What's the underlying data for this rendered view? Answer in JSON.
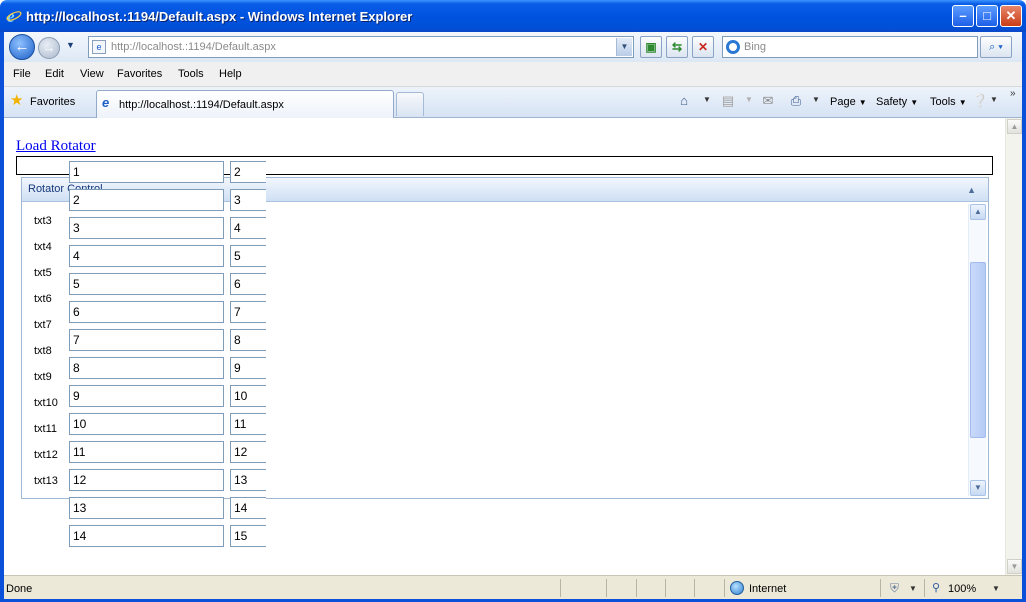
{
  "window": {
    "title": "http://localhost.:1194/Default.aspx - Windows Internet Explorer",
    "minimize": "–",
    "maximize": "□",
    "close": "✕"
  },
  "nav": {
    "address": "http://localhost.:1194/Default.aspx",
    "search_placeholder": "Bing",
    "back_glyph": "←",
    "forward_glyph": "→",
    "refresh_glyph": "⇆",
    "stop_glyph": "✕",
    "compat_glyph": "▣",
    "search_glyph": "⌕"
  },
  "menu": {
    "items": [
      "File",
      "Edit",
      "View",
      "Favorites",
      "Tools",
      "Help"
    ]
  },
  "tabs": {
    "favorites_label": "Favorites",
    "active_tab_label": "http://localhost.:1194/Default.aspx",
    "commands": {
      "page": "Page",
      "safety": "Safety",
      "tools": "Tools"
    },
    "chevron": "»"
  },
  "page": {
    "link": "Load Rotator",
    "panel_title": "Rotator Control",
    "row_labels": [
      "txt3",
      "txt4",
      "txt5",
      "txt6",
      "txt7",
      "txt8",
      "txt9",
      "txt10",
      "txt11",
      "txt12",
      "txt13"
    ],
    "col_a_values": [
      "1",
      "2",
      "3",
      "4",
      "5",
      "6",
      "7",
      "8",
      "9",
      "10",
      "11",
      "12",
      "13",
      "14"
    ],
    "col_b_values": [
      "2",
      "3",
      "4",
      "5",
      "6",
      "7",
      "8",
      "9",
      "10",
      "11",
      "12",
      "13",
      "14",
      "15"
    ]
  },
  "status": {
    "text": "Done",
    "zone": "Internet",
    "zoom": "100%"
  },
  "colors": {
    "title_bar": "#0053e0",
    "link": "#0000ee",
    "panel_header": "#cfe0f4"
  }
}
